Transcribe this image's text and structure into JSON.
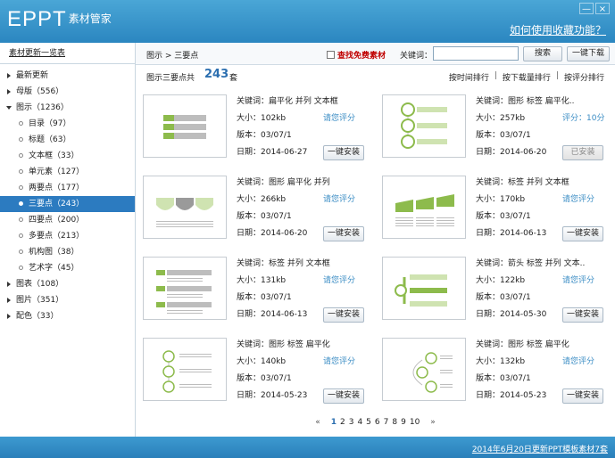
{
  "app": {
    "logo_main": "EPPT",
    "logo_sub": "素材管家",
    "help_link": "如何使用收藏功能？"
  },
  "window": {
    "minimize": "—",
    "close": "×"
  },
  "sidebar": {
    "title": "素材更新一览表",
    "items": [
      {
        "label": "最新更新",
        "level": 0,
        "expanded": false
      },
      {
        "label": "母版（556）",
        "level": 0,
        "expanded": false
      },
      {
        "label": "图示（1236）",
        "level": 0,
        "expanded": true
      },
      {
        "label": "目录（97）",
        "level": 1
      },
      {
        "label": "标题（63）",
        "level": 1
      },
      {
        "label": "文本框（33）",
        "level": 1
      },
      {
        "label": "单元素（127）",
        "level": 1
      },
      {
        "label": "两要点（177）",
        "level": 1
      },
      {
        "label": "三要点（243）",
        "level": 1,
        "selected": true
      },
      {
        "label": "四要点（200）",
        "level": 1
      },
      {
        "label": "多要点（213）",
        "level": 1
      },
      {
        "label": "机构图（38）",
        "level": 1
      },
      {
        "label": "艺术字（45）",
        "level": 1
      },
      {
        "label": "图表（108）",
        "level": 0,
        "expanded": false
      },
      {
        "label": "图片（351）",
        "level": 0,
        "expanded": false
      },
      {
        "label": "配色（33）",
        "level": 0,
        "expanded": false
      }
    ]
  },
  "toolbar": {
    "breadcrumb": "图示 > 三要点",
    "free_label": "查找免费素材",
    "keyword_label": "关键词：",
    "keyword_value": "",
    "search_label": "搜索",
    "download_label": "一键下载"
  },
  "summary": {
    "prefix": "图示三要点共",
    "count": "243",
    "unit": "套",
    "sort_time": "按时间排行",
    "sort_downloads": "按下载量排行",
    "sort_rating": "按评分排行",
    "sep": "|"
  },
  "cards": [
    {
      "keywords": "关键词：扁平化 并列 文本框",
      "size": "大小：102kb",
      "version": "版本：03/07/1",
      "date": "日期：2014-06-27",
      "rating": "请您评分",
      "button": "一键安装",
      "installed": false
    },
    {
      "keywords": "关键词：图形 标签 扁平化..",
      "size": "大小：257kb",
      "version": "版本：03/07/1",
      "date": "日期：2014-06-20",
      "rating": "评分：10分",
      "button": "已安装",
      "installed": true
    },
    {
      "keywords": "关键词：图形 扁平化 并列",
      "size": "大小：266kb",
      "version": "版本：03/07/1",
      "date": "日期：2014-06-20",
      "rating": "请您评分",
      "button": "一键安装",
      "installed": false
    },
    {
      "keywords": "关键词：标签 并列 文本框",
      "size": "大小：170kb",
      "version": "版本：03/07/1",
      "date": "日期：2014-06-13",
      "rating": "请您评分",
      "button": "一键安装",
      "installed": false
    },
    {
      "keywords": "关键词：标签 并列 文本框",
      "size": "大小：131kb",
      "version": "版本：03/07/1",
      "date": "日期：2014-06-13",
      "rating": "请您评分",
      "button": "一键安装",
      "installed": false
    },
    {
      "keywords": "关键词：箭头 标签 并列 文本..",
      "size": "大小：122kb",
      "version": "版本：03/07/1",
      "date": "日期：2014-05-30",
      "rating": "请您评分",
      "button": "一键安装",
      "installed": false
    },
    {
      "keywords": "关键词：图形 标签 扁平化",
      "size": "大小：140kb",
      "version": "版本：03/07/1",
      "date": "日期：2014-05-23",
      "rating": "请您评分",
      "button": "一键安装",
      "installed": false
    },
    {
      "keywords": "关键词：图形 标签 扁平化",
      "size": "大小：132kb",
      "version": "版本：03/07/1",
      "date": "日期：2014-05-23",
      "rating": "请您评分",
      "button": "一键安装",
      "installed": false
    }
  ],
  "pager": {
    "prev": "«",
    "next": "»",
    "current": "1",
    "pages": [
      "1",
      "2",
      "3",
      "4",
      "5",
      "6",
      "7",
      "8",
      "9",
      "10"
    ]
  },
  "footer": {
    "link": "2014年6月20日更新PPT模板素材7套"
  },
  "colors": {
    "title_bar": "#2b86c0",
    "selected": "#2c7bc0",
    "accent_green": "#8dbb4c",
    "free_red": "#c00000"
  },
  "icons": [
    "minimize-icon",
    "close-icon",
    "expand-arrow-icon",
    "collapse-arrow-icon",
    "bullet-icon",
    "checkbox-icon"
  ]
}
